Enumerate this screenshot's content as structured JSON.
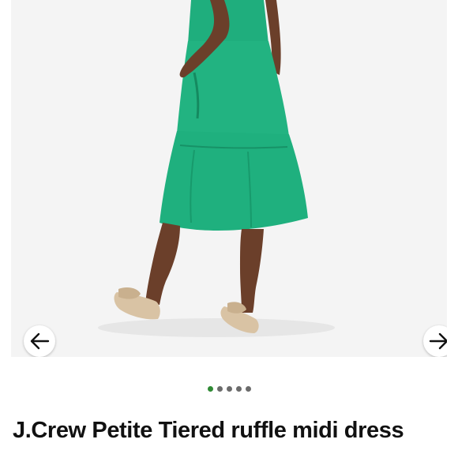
{
  "product": {
    "brand": "J.Crew",
    "title": "Petite Tiered ruffle midi dress"
  },
  "carousel": {
    "image_alt": "Model wearing a green tiered midi dress with espadrille sandals",
    "dress_color": "#1fb07e",
    "prev_icon": "arrow-left-icon",
    "next_icon": "arrow-right-icon",
    "dot_count": 5,
    "active_dot": 1,
    "active_dot_color": "#2f8a34"
  }
}
